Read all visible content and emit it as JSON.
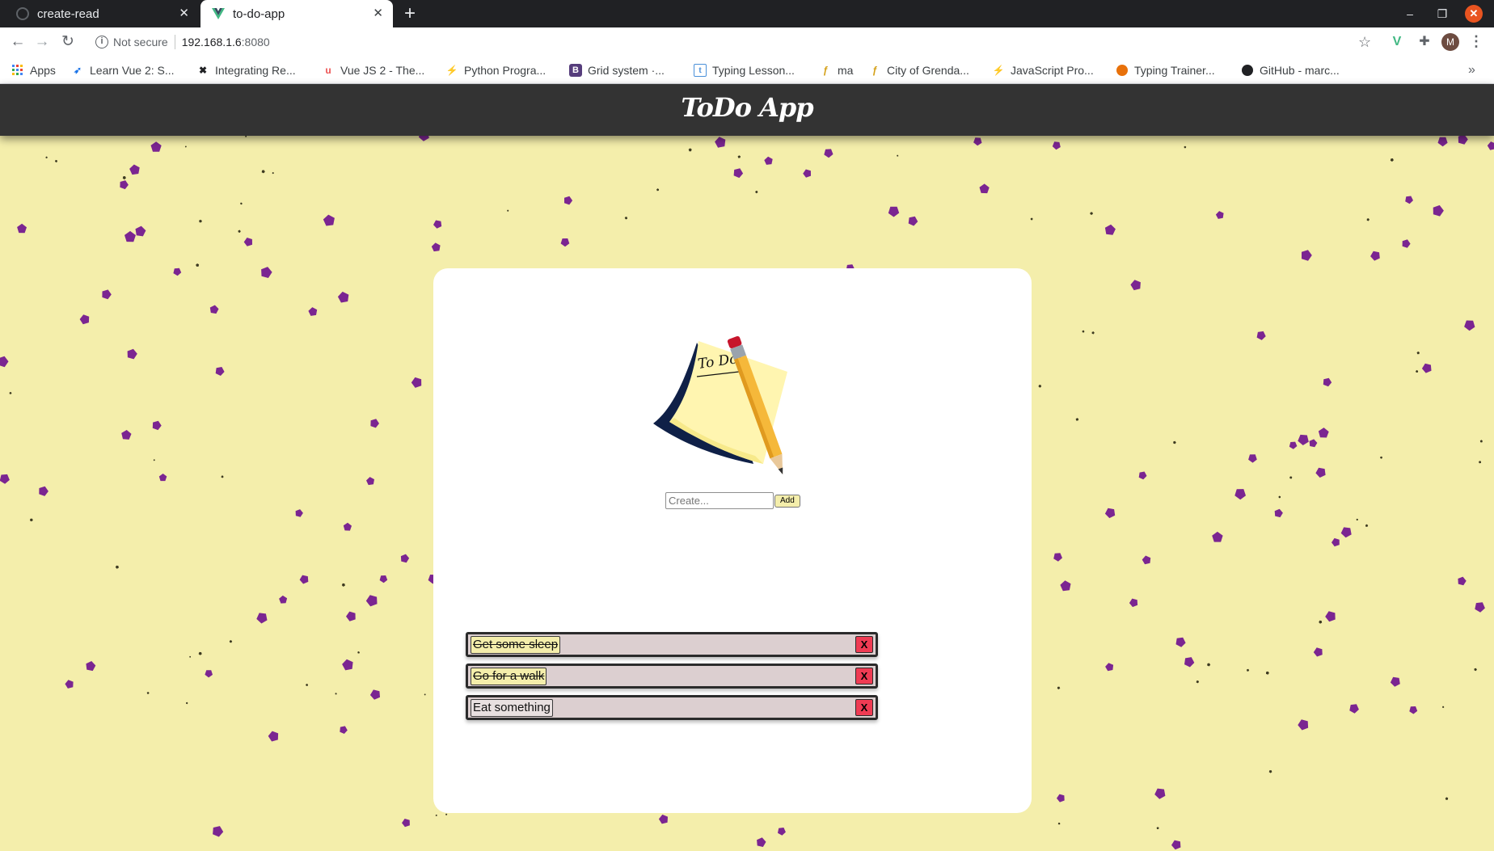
{
  "browser": {
    "tabs": [
      {
        "title": "create-read",
        "active": false
      },
      {
        "title": "to-do-app",
        "active": true
      }
    ],
    "new_tab": "+",
    "security_text": "Not secure",
    "url_host": "192.168.1.6",
    "url_port": ":8080",
    "avatar_initial": "M",
    "window_controls": {
      "minimize": "–",
      "maximize": "❐",
      "close": "✕"
    }
  },
  "bookmarks": [
    {
      "label": "Apps",
      "icon": "apps-grid-icon",
      "color": "#4285f4"
    },
    {
      "label": "Learn Vue 2: S...",
      "icon": "paper-plane-icon",
      "color": "#1a73e8"
    },
    {
      "label": "Integrating Re...",
      "icon": "x-logo-icon",
      "color": "#202124"
    },
    {
      "label": "Vue JS 2 - The...",
      "icon": "udemy-icon",
      "color": "#ec5252"
    },
    {
      "label": "Python Progra...",
      "icon": "lightning-icon",
      "color": "#5f6368"
    },
    {
      "label": "Grid system ·...",
      "icon": "bootstrap-icon",
      "color": "#563d7c"
    },
    {
      "label": "Typing Lesson...",
      "icon": "typing-t-icon",
      "color": "#4a90d9"
    },
    {
      "label": "ma",
      "icon": "feather-icon",
      "color": "#d4a017"
    },
    {
      "label": "City of Grenda...",
      "icon": "feather-icon",
      "color": "#d4a017"
    },
    {
      "label": "JavaScript Pro...",
      "icon": "lightning-icon",
      "color": "#5f6368"
    },
    {
      "label": "Typing Trainer...",
      "icon": "typing-ball-icon",
      "color": "#e8710a"
    },
    {
      "label": "GitHub - marc...",
      "icon": "github-icon",
      "color": "#202124"
    }
  ],
  "app": {
    "title": "ToDo App",
    "create_placeholder": "Create...",
    "create_value": "",
    "add_label": "Add",
    "todos": [
      {
        "text": "Get some sleep",
        "done": true
      },
      {
        "text": "Go for a walk",
        "done": true
      },
      {
        "text": "Eat something",
        "done": false
      }
    ],
    "delete_label": "X"
  },
  "colors": {
    "background": "#f4eeab",
    "header": "#333333",
    "confetti": "#7b2591",
    "delete": "#ef3b53",
    "todo_bar": "#dccfd0"
  }
}
